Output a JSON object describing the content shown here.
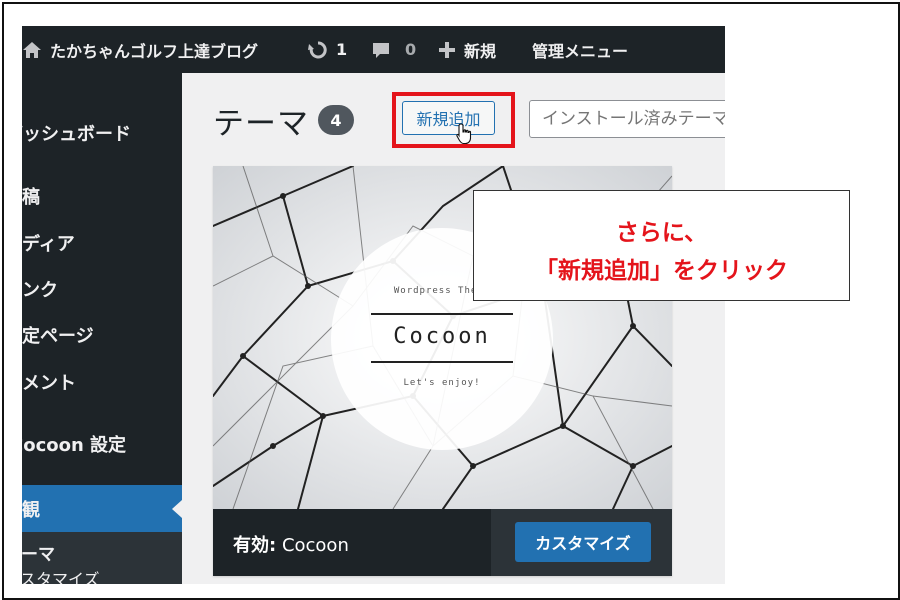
{
  "admin_bar": {
    "site_name": "たかちゃんゴルフ上達ブログ",
    "updates_count": "1",
    "comments_count": "0",
    "new_label": "新規",
    "admin_menu_label": "管理メニュー"
  },
  "sidebar": {
    "items": [
      {
        "label": "ダッシュボード"
      },
      {
        "label": "投稿"
      },
      {
        "label": "メディア"
      },
      {
        "label": "リンク"
      },
      {
        "label": "固定ページ"
      },
      {
        "label": "コメント"
      },
      {
        "label": "Cocoon 設定"
      },
      {
        "label": "外観"
      }
    ],
    "submenu": [
      {
        "label": "テーマ"
      },
      {
        "label": "カスタマイズ"
      }
    ]
  },
  "main": {
    "page_title": "テーマ",
    "theme_count": "4",
    "add_new_label": "新規追加",
    "search_placeholder": "インストール済みテーマを検索..."
  },
  "theme": {
    "logo_tagline_top": "Wordpress Theme",
    "logo_name": "Cocoon",
    "logo_tagline_bottom": "Let's enjoy!",
    "active_label": "有効:",
    "name": "Cocoon",
    "customize_label": "カスタマイズ"
  },
  "callout": {
    "line1": "さらに、",
    "line2": "「新規追加」をクリック"
  },
  "colors": {
    "admin_dark": "#1d2327",
    "wp_blue": "#2271b1",
    "highlight_red": "#e4141b"
  }
}
